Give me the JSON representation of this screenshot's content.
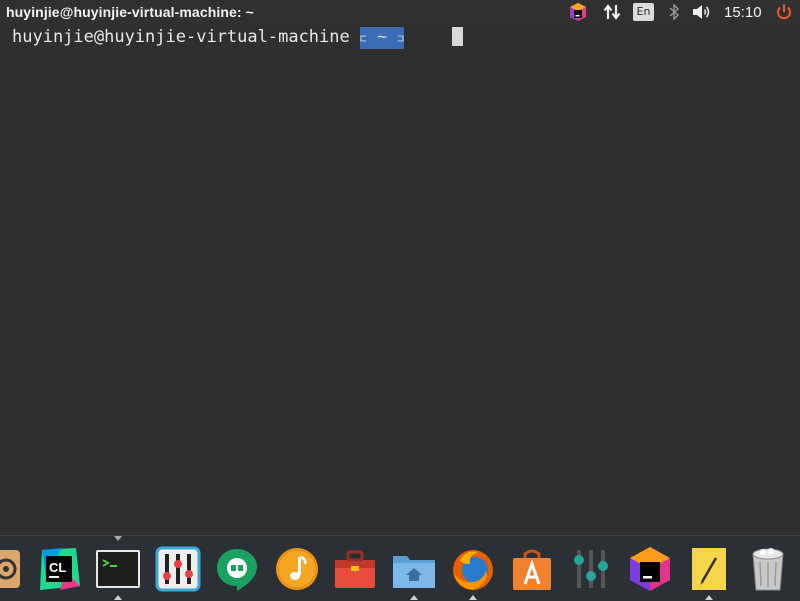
{
  "window": {
    "title": "huyinjie@huyinjie-virtual-machine: ~"
  },
  "tray": {
    "language": "En",
    "clock": "15:10",
    "icons": [
      "app-indicator-icon",
      "network-icon",
      "keyboard-language-icon",
      "bluetooth-icon",
      "volume-icon",
      "power-icon"
    ]
  },
  "terminal": {
    "prompt_user_host": "huyinjie@huyinjie-virtual-machine",
    "prompt_dir": " ~ ",
    "accent": "#3a6db5"
  },
  "dock": {
    "items": [
      {
        "name": "dock-item-partial",
        "running": false
      },
      {
        "name": "dock-item-clion",
        "running": false
      },
      {
        "name": "dock-item-terminal",
        "running": true
      },
      {
        "name": "dock-item-mixer",
        "running": false
      },
      {
        "name": "dock-item-hangouts",
        "running": false
      },
      {
        "name": "dock-item-music",
        "running": false
      },
      {
        "name": "dock-item-toolbox",
        "running": false
      },
      {
        "name": "dock-item-files",
        "running": true
      },
      {
        "name": "dock-item-firefox",
        "running": true
      },
      {
        "name": "dock-item-software-center",
        "running": false
      },
      {
        "name": "dock-item-settings",
        "running": false
      },
      {
        "name": "dock-item-jetbrains-toolbox",
        "running": false
      },
      {
        "name": "dock-item-notes",
        "running": true
      },
      {
        "name": "dock-item-trash",
        "running": false
      }
    ]
  }
}
